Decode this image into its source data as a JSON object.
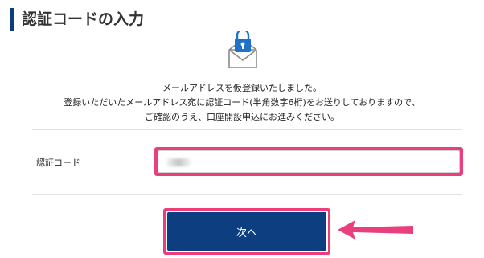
{
  "header": {
    "title": "認証コードの入力"
  },
  "message": {
    "lines": [
      "メールアドレスを仮登録いたしました。",
      "登録いただいたメールアドレス宛に認証コード(半角数字6桁)をお送りしておりますので、",
      "ご確認のうえ、口座開設申込にお進みください。"
    ]
  },
  "form": {
    "code_label": "認証コード"
  },
  "actions": {
    "next_label": "次へ"
  },
  "colors": {
    "accent": "#0d3f80",
    "highlight": "#ea3f7c"
  },
  "icons": {
    "envelope": "envelope-lock-icon",
    "arrow": "arrow-left-icon"
  }
}
